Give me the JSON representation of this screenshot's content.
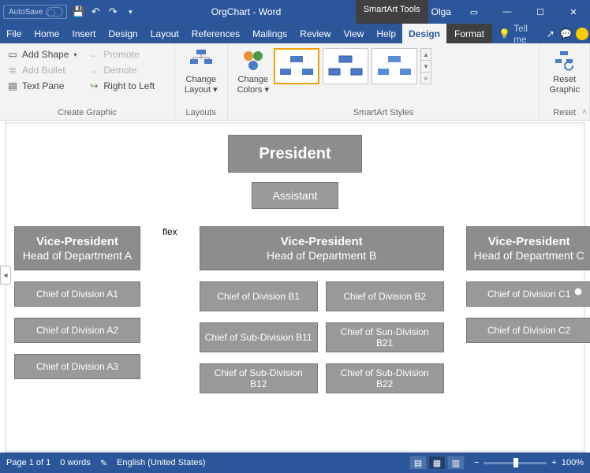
{
  "titlebar": {
    "autosave": "AutoSave",
    "title": "OrgChart - Word",
    "tools": "SmartArt Tools",
    "user": "Olga"
  },
  "tabs": {
    "file": "File",
    "home": "Home",
    "insert": "Insert",
    "design0": "Design",
    "layout": "Layout",
    "references": "References",
    "mailings": "Mailings",
    "review": "Review",
    "view": "View",
    "help": "Help",
    "design": "Design",
    "format": "Format",
    "tellme": "Tell me"
  },
  "ribbon": {
    "create": {
      "addshape": "Add Shape",
      "addbullet": "Add Bullet",
      "textpane": "Text Pane",
      "promote": "Promote",
      "demote": "Demote",
      "rtl": "Right to Left",
      "label": "Create Graphic"
    },
    "layouts": {
      "change": "Change",
      "layout": "Layout",
      "label": "Layouts"
    },
    "styles": {
      "change": "Change",
      "colors": "Colors",
      "label": "SmartArt Styles"
    },
    "reset": {
      "reset": "Reset",
      "graphic": "Graphic",
      "label": "Reset"
    }
  },
  "org": {
    "president": "President",
    "assistant": "Assistant",
    "vpA": {
      "title": "Vice-President",
      "sub": "Head of Department A"
    },
    "vpB": {
      "title": "Vice-President",
      "sub": "Head of Department B"
    },
    "vpC": {
      "title": "Vice-President",
      "sub": "Head of Department C"
    },
    "a1": "Chief of Division A1",
    "a2": "Chief of Division A2",
    "a3": "Chief of Division A3",
    "b1": "Chief of Division B1",
    "b2": "Chief of Division B2",
    "b11": "Chief of Sub-Division B11",
    "b21": "Chief of Sun-Division B21",
    "b12": "Chief of Sub-Division B12",
    "b22": "Chief of Sub-Division B22",
    "c1": "Chief of Division C1",
    "c2": "Chief of Division C2"
  },
  "status": {
    "page": "Page 1 of 1",
    "words": "0 words",
    "lang": "English (United States)",
    "zoom": "100%"
  }
}
